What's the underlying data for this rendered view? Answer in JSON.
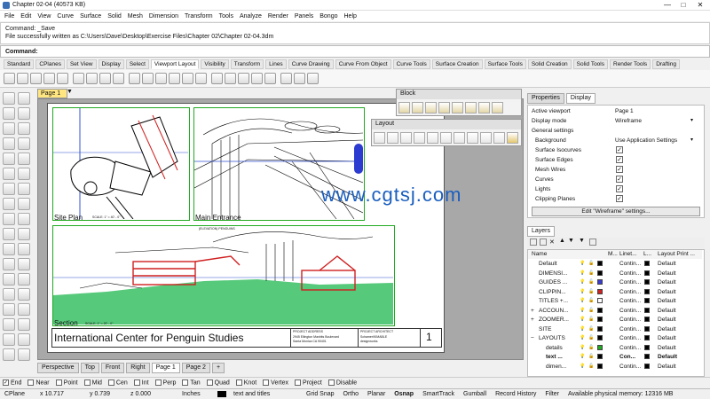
{
  "window": {
    "title": "Chapter 02-04 (40573 KB)",
    "minimize": "—",
    "maximize": "□",
    "close": "✕"
  },
  "menu": [
    "File",
    "Edit",
    "View",
    "Curve",
    "Surface",
    "Solid",
    "Mesh",
    "Dimension",
    "Transform",
    "Tools",
    "Analyze",
    "Render",
    "Panels",
    "Bongo",
    "Help"
  ],
  "command": {
    "history_line1": "Command: _Save",
    "history_line2": "File successfully written as C:\\Users\\Dave\\Desktop\\Exercise Files\\Chapter 02\\Chapter 02-04.3dm",
    "prompt": "Command:"
  },
  "toolbar_tabs": [
    "Standard",
    "CPlanes",
    "Set View",
    "Display",
    "Select",
    "Viewport Layout",
    "Visibility",
    "Transform",
    "Lines",
    "Curve Drawing",
    "Curve From Object",
    "Curve Tools",
    "Surface Creation",
    "Surface Tools",
    "Solid Creation",
    "Solid Tools",
    "Render Tools",
    "Drafting"
  ],
  "toolbar_tabs_selected": "Viewport Layout",
  "viewport": {
    "active_tab": "Page 1",
    "sheet": {
      "site_plan_label": "Site Plan",
      "site_plan_scale": "SCALE: 1\" = 40' - 0\"",
      "main_entrance_label": "Main Entrance",
      "section_label": "Section",
      "section_scale": "SCALE: 1\" = 20' - 0\"",
      "elevation_caption": "(ELEVATION) PENGUINS",
      "title": "International Center for Penguin Studies",
      "address_header": "PROJECT ADDRESS",
      "address_line1": "2945 Ellington Maxbits Boulevard",
      "address_line2": "Santa Monica CA 90401",
      "architect_header": "PROJECT ARCHITECT",
      "architect_line1": "Schamer/KIMABLE",
      "architect_line2": "designworks",
      "sheet_number": "1"
    }
  },
  "floating": {
    "block_title": "Block",
    "layout_title": "Layout"
  },
  "watermark": "www.cgtsj.com",
  "viewport_tabs": [
    "Perspective",
    "Top",
    "Front",
    "Right",
    "Page 1",
    "Page 2",
    "+"
  ],
  "viewport_tabs_selected": "Page 1",
  "osnaps": [
    {
      "label": "End",
      "on": true
    },
    {
      "label": "Near",
      "on": false
    },
    {
      "label": "Point",
      "on": false
    },
    {
      "label": "Mid",
      "on": false
    },
    {
      "label": "Cen",
      "on": false
    },
    {
      "label": "Int",
      "on": false
    },
    {
      "label": "Perp",
      "on": false
    },
    {
      "label": "Tan",
      "on": false
    },
    {
      "label": "Quad",
      "on": false
    },
    {
      "label": "Knot",
      "on": false
    },
    {
      "label": "Vertex",
      "on": false
    },
    {
      "label": "Project",
      "on": false
    },
    {
      "label": "Disable",
      "on": false
    }
  ],
  "status": {
    "cplane": "CPlane",
    "x": "x 10.717",
    "y": "y 0.739",
    "z": "z 0.000",
    "units": "Inches",
    "layer": "text and titles",
    "grid_snap": "Grid Snap",
    "ortho": "Ortho",
    "planar": "Planar",
    "osnap": "Osnap",
    "smarttrack": "SmartTrack",
    "gumball": "Gumball",
    "record_history": "Record History",
    "filter": "Filter",
    "memory": "Available physical memory: 12316 MB"
  },
  "properties": {
    "tabs": [
      "Properties",
      "Display"
    ],
    "selected_tab": "Display",
    "active_viewport_label": "Active viewport",
    "active_viewport_value": "Page 1",
    "display_mode_label": "Display mode",
    "display_mode_value": "Wireframe",
    "general_settings": "General settings",
    "background_label": "Background",
    "background_value": "Use Application Settings",
    "checks": [
      {
        "label": "Surface Isocurves",
        "on": true
      },
      {
        "label": "Surface Edges",
        "on": true
      },
      {
        "label": "Mesh Wires",
        "on": true
      },
      {
        "label": "Curves",
        "on": true
      },
      {
        "label": "Lights",
        "on": true
      },
      {
        "label": "Clipping Planes",
        "on": true
      }
    ],
    "edit_button": "Edit \"Wireframe\" settings..."
  },
  "layers": {
    "title": "Layers",
    "col_name": "Name",
    "col_m": "M...",
    "col_linetype": "Linet...",
    "col_l": "L...",
    "col_print": "Layout Print ...",
    "rows": [
      {
        "name": "Default",
        "linetype": "Contin...",
        "print": "Default",
        "color": "#000000",
        "indent": 0,
        "expander": ""
      },
      {
        "name": "DIMENSI...",
        "linetype": "Contin...",
        "print": "Default",
        "color": "#000000",
        "indent": 0,
        "expander": ""
      },
      {
        "name": "GUIDES ...",
        "linetype": "Contin...",
        "print": "Default",
        "color": "#3a3ad0",
        "indent": 0,
        "expander": ""
      },
      {
        "name": "CLIPPIN...",
        "linetype": "Contin...",
        "print": "Default",
        "color": "#d02020",
        "indent": 0,
        "expander": ""
      },
      {
        "name": "TITLES +...",
        "linetype": "Contin...",
        "print": "Default",
        "color": "#ffffff",
        "indent": 0,
        "expander": ""
      },
      {
        "name": "ACCOUN...",
        "linetype": "Contin...",
        "print": "Default",
        "color": "#000000",
        "indent": 0,
        "expander": "+"
      },
      {
        "name": "ZOOMER...",
        "linetype": "Contin...",
        "print": "Default",
        "color": "#000000",
        "indent": 0,
        "expander": "+"
      },
      {
        "name": "SITE",
        "linetype": "Contin...",
        "print": "Default",
        "color": "#000000",
        "indent": 0,
        "expander": ""
      },
      {
        "name": "LAYOUTS",
        "linetype": "Contin...",
        "print": "Default",
        "color": "#000000",
        "indent": 0,
        "expander": "−"
      },
      {
        "name": "details",
        "linetype": "Contin...",
        "print": "Default",
        "color": "#22aa22",
        "indent": 1,
        "expander": ""
      },
      {
        "name": "text ...",
        "linetype": "Con...",
        "print": "Default",
        "color": "#000000",
        "indent": 1,
        "expander": "",
        "current": true
      },
      {
        "name": "dimen...",
        "linetype": "Contin...",
        "print": "Default",
        "color": "#000000",
        "indent": 1,
        "expander": ""
      }
    ]
  }
}
